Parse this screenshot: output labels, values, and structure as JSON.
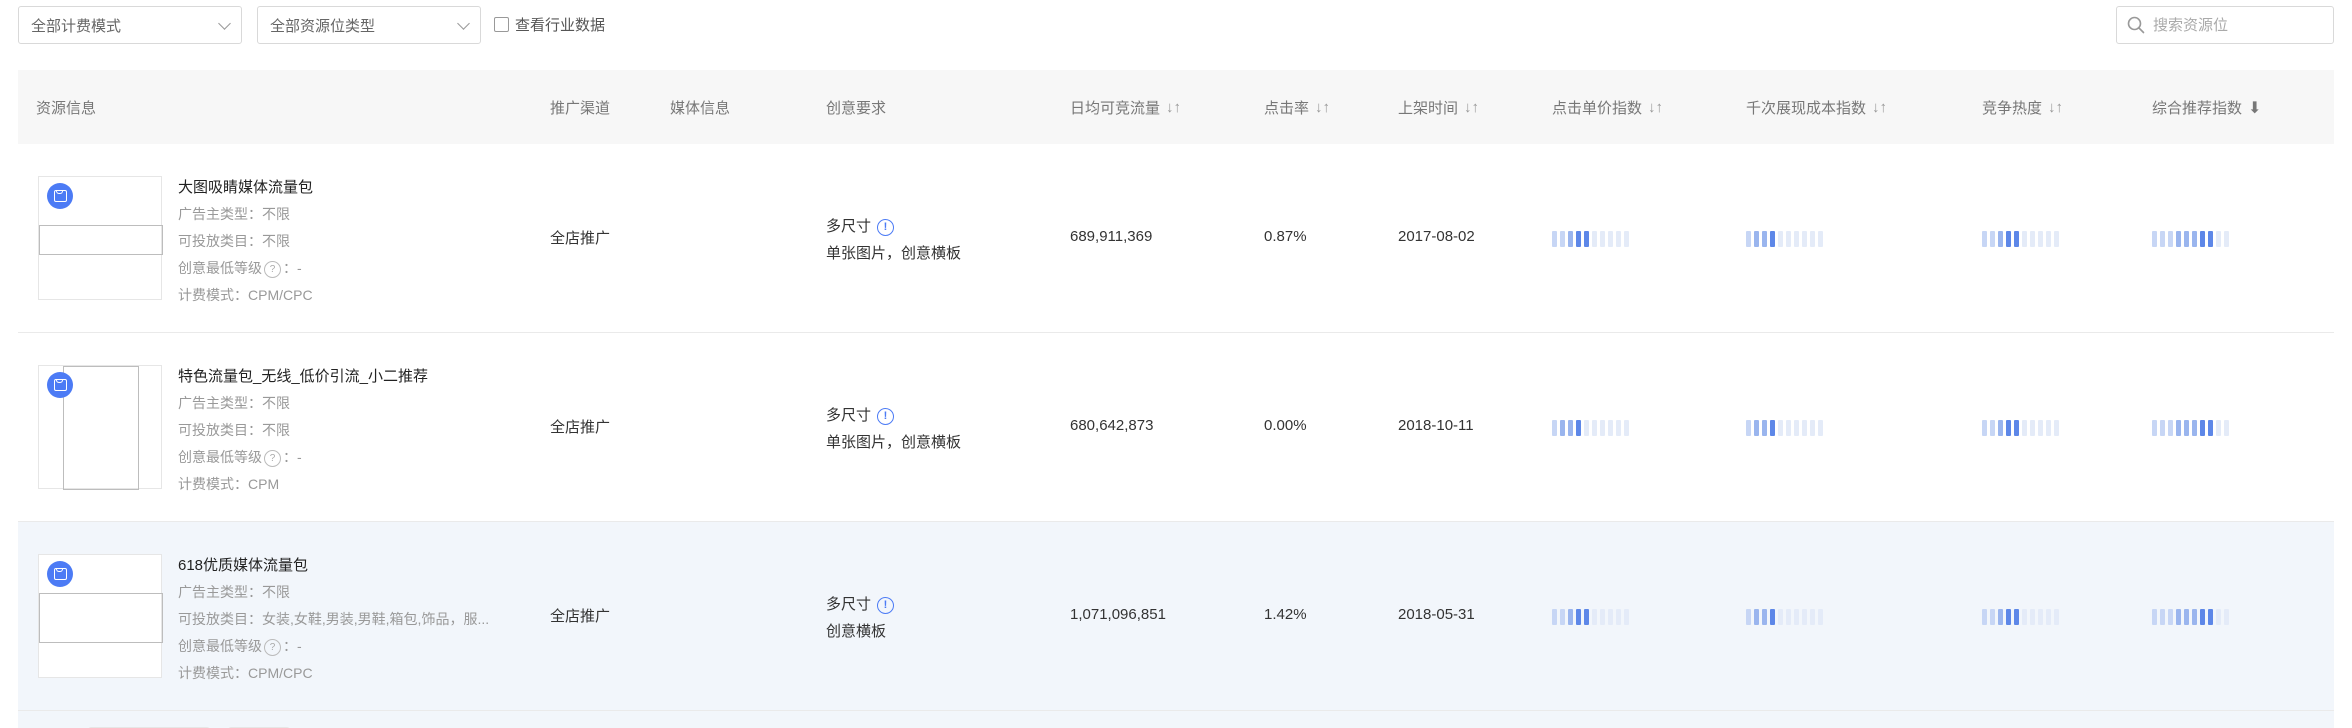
{
  "filters": {
    "billing_mode": "全部计费模式",
    "resource_type": "全部资源位类型",
    "industry_checkbox": "查看行业数据",
    "search_placeholder": "搜索资源位"
  },
  "table": {
    "headers": {
      "resource_info": "资源信息",
      "channel": "推广渠道",
      "media_info": "媒体信息",
      "creative_req": "创意要求",
      "daily_traffic": "日均可竞流量",
      "ctr": "点击率",
      "listed_time": "上架时间",
      "cpc_index": "点击单价指数",
      "cpm_index": "千次展现成本指数",
      "competition": "竞争热度",
      "recommend_index": "综合推荐指数"
    },
    "labels": {
      "ad_type": "广告主类型：",
      "category": "可投放类目：",
      "min_level_a": "创意最低等级",
      "min_level_b": "：",
      "billing": "计费模式："
    },
    "rows": [
      {
        "name": "大图吸睛媒体流量包",
        "ad_type": "不限",
        "category": "不限",
        "min_level": "-",
        "billing": "CPM/CPC",
        "channel": "全店推广",
        "size": "多尺寸",
        "formats": "单张图片，创意横板",
        "traffic": "689,911,369",
        "ctr": "0.87%",
        "date": "2017-08-02",
        "cpc_index": 0.45,
        "cpm_index": 0.4,
        "competition": 0.5,
        "recommend": 0.75
      },
      {
        "name": "特色流量包_无线_低价引流_小二推荐",
        "ad_type": "不限",
        "category": "不限",
        "min_level": "-",
        "billing": "CPM",
        "channel": "全店推广",
        "size": "多尺寸",
        "formats": "单张图片，创意横板",
        "traffic": "680,642,873",
        "ctr": "0.00%",
        "date": "2018-10-11",
        "cpc_index": 0.4,
        "cpm_index": 0.4,
        "competition": 0.5,
        "recommend": 0.75
      },
      {
        "name": "618优质媒体流量包",
        "ad_type": "不限",
        "category": "女装,女鞋,男装,男鞋,箱包,饰品，服...",
        "min_level": "-",
        "billing": "CPM/CPC",
        "channel": "全店推广",
        "size": "多尺寸",
        "formats": "创意横板",
        "traffic": "1,071,096,851",
        "ctr": "1.42%",
        "date": "2018-05-31",
        "cpc_index": 0.45,
        "cpm_index": 0.4,
        "competition": 0.5,
        "recommend": 0.75
      }
    ]
  }
}
